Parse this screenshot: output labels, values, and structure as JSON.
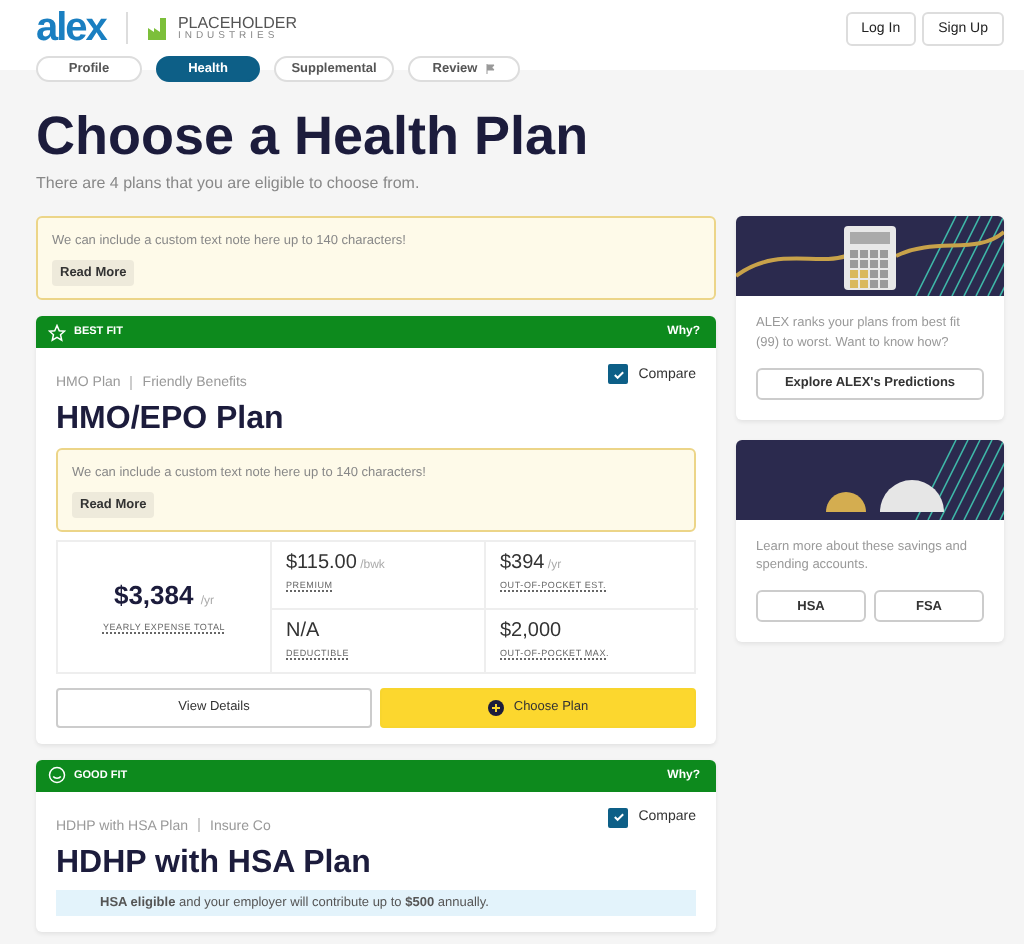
{
  "header": {
    "logo": "alex",
    "partner": {
      "name": "PLACEHOLDER",
      "tagline": "INDUSTRIES"
    },
    "buttons": [
      "Log In",
      "Sign Up"
    ]
  },
  "tabs": [
    {
      "label": "Profile",
      "selected": false,
      "flag": false
    },
    {
      "label": "Health",
      "selected": true,
      "flag": false
    },
    {
      "label": "Supplemental",
      "selected": false,
      "flag": false
    },
    {
      "label": "Review",
      "selected": false,
      "flag": true
    }
  ],
  "title": "Choose a Health Plan",
  "subtitle": "There are 4 plans that you are eligible to choose from.",
  "note": {
    "text": "We can include a custom text note here up to 140 characters!",
    "button": "Read More"
  },
  "plans": [
    {
      "badge": "BEST FIT",
      "why": "Why?",
      "type": "HMO Plan",
      "carrier": "Friendly Benefits",
      "name": "HMO/EPO Plan",
      "compare": {
        "label": "Compare",
        "checked": true
      },
      "note": {
        "text": "We can include a custom text note here up to 140 characters!",
        "button": "Read More"
      },
      "total": {
        "amount": "$3,384",
        "unit": "/yr",
        "label": "YEARLY EXPENSE TOTAL"
      },
      "stats": [
        {
          "value": "$115.00",
          "unit": "/bwk",
          "label": "PREMIUM"
        },
        {
          "value": "$394",
          "unit": "/yr",
          "label": "OUT-OF-POCKET EST."
        },
        {
          "value": "N/A",
          "label": "DEDUCTIBLE"
        },
        {
          "value": "$2,000",
          "label": "OUT-OF-POCKET MAX."
        }
      ],
      "details_button": "View Details",
      "choose_button": "Choose Plan"
    },
    {
      "badge": "GOOD FIT",
      "why": "Why?",
      "type": "HDHP with HSA Plan",
      "carrier": "Insure Co",
      "name": "HDHP with HSA Plan",
      "compare": {
        "label": "Compare",
        "checked": true
      },
      "hsa_note": "**HSA eligible** and your employer will contribute up to **$500** annually."
    }
  ],
  "sidebar": [
    {
      "text": "ALEX ranks your plans from best fit (99) to worst. Want to know how?",
      "buttons": [
        "Explore ALEX's Predictions"
      ]
    },
    {
      "text": "Learn more about these savings and spending accounts.",
      "buttons": [
        "HSA",
        "FSA"
      ]
    }
  ]
}
